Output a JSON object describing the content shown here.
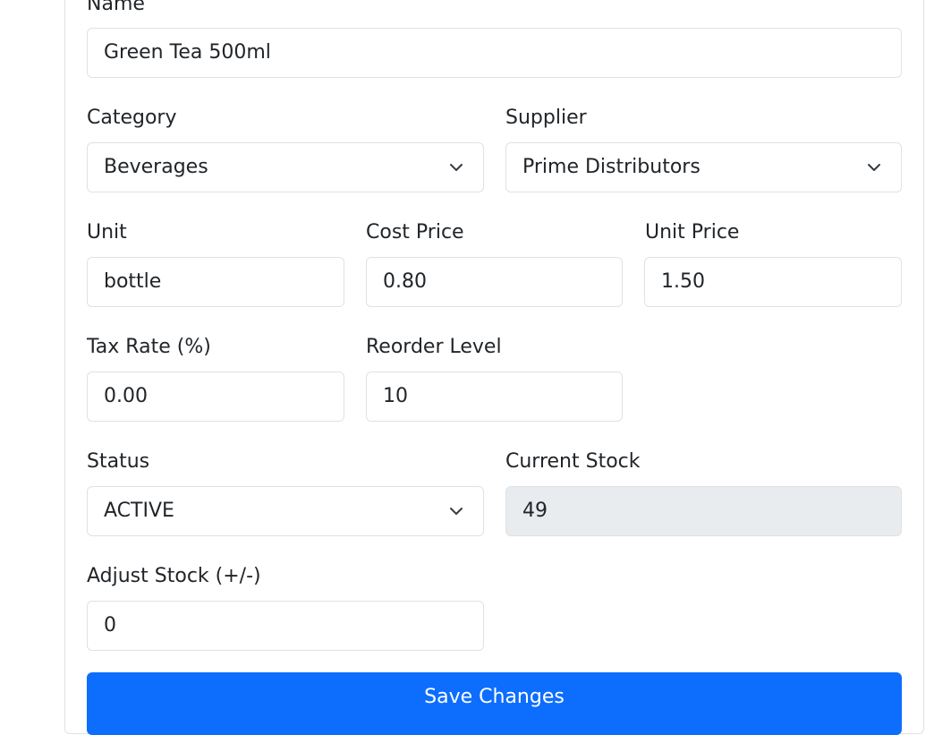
{
  "form": {
    "name": {
      "label": "Name",
      "value": "Green Tea 500ml"
    },
    "category": {
      "label": "Category",
      "value": "Beverages",
      "icon": "chevron-down-icon"
    },
    "supplier": {
      "label": "Supplier",
      "value": "Prime Distributors",
      "icon": "chevron-down-icon"
    },
    "unit": {
      "label": "Unit",
      "value": "bottle"
    },
    "cost_price": {
      "label": "Cost Price",
      "value": "0.80"
    },
    "unit_price": {
      "label": "Unit Price",
      "value": "1.50"
    },
    "tax_rate": {
      "label": "Tax Rate (%)",
      "value": "0.00"
    },
    "reorder_level": {
      "label": "Reorder Level",
      "value": "10"
    },
    "status": {
      "label": "Status",
      "value": "ACTIVE",
      "icon": "chevron-down-icon"
    },
    "current_stock": {
      "label": "Current Stock",
      "value": "49"
    },
    "adjust_stock": {
      "label": "Adjust Stock (+/-)",
      "value": "0"
    },
    "save_label": "Save Changes"
  },
  "colors": {
    "primary": "#0d6efd",
    "border": "#dee2e6",
    "readonly_bg": "#e9ecef",
    "text": "#212529"
  }
}
